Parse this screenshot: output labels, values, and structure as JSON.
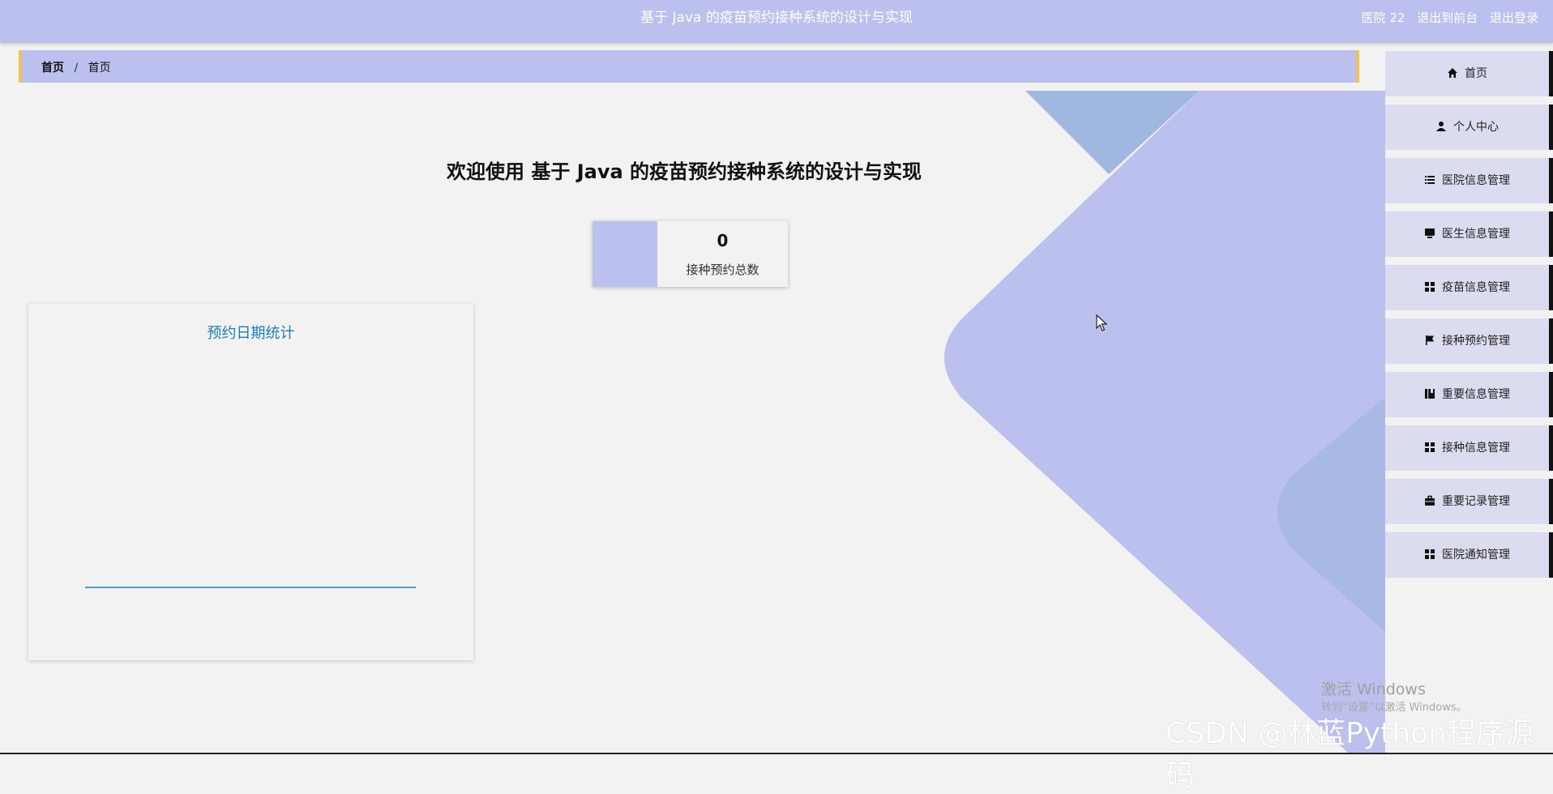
{
  "header": {
    "title": "基于 Java 的疫苗预约接种系统的设计与实现",
    "user": "医院 22",
    "to_front": "退出到前台",
    "logout": "退出登录"
  },
  "breadcrumb": {
    "first": "首页",
    "separator": "/",
    "second": "首页"
  },
  "welcome": "欢迎使用 基于 Java 的疫苗预约接种系统的设计与实现",
  "stat": {
    "value": "0",
    "label": "接种预约总数"
  },
  "chart_data": {
    "type": "line",
    "title": "预约日期统计",
    "categories": [],
    "series": [],
    "xlabel": "",
    "ylabel": ""
  },
  "sidebar": {
    "items": [
      {
        "label": "首页",
        "icon": "home-icon"
      },
      {
        "label": "个人中心",
        "icon": "user-icon"
      },
      {
        "label": "医院信息管理",
        "icon": "list-icon"
      },
      {
        "label": "医生信息管理",
        "icon": "desktop-icon"
      },
      {
        "label": "疫苗信息管理",
        "icon": "grid-icon"
      },
      {
        "label": "接种预约管理",
        "icon": "flag-icon"
      },
      {
        "label": "重要信息管理",
        "icon": "book-icon"
      },
      {
        "label": "接种信息管理",
        "icon": "grid-icon"
      },
      {
        "label": "重要记录管理",
        "icon": "briefcase-icon"
      },
      {
        "label": "医院通知管理",
        "icon": "grid-icon"
      }
    ]
  },
  "watermarks": {
    "activate_title": "激活 Windows",
    "activate_sub": "转到“设置”以激活 Windows。",
    "csdn": "CSDN @林蓝Python程序源码"
  },
  "colors": {
    "accent": "#bcc0ee",
    "breadcrumb_border": "#f2c14e",
    "chart_line": "#1e7fb8"
  }
}
